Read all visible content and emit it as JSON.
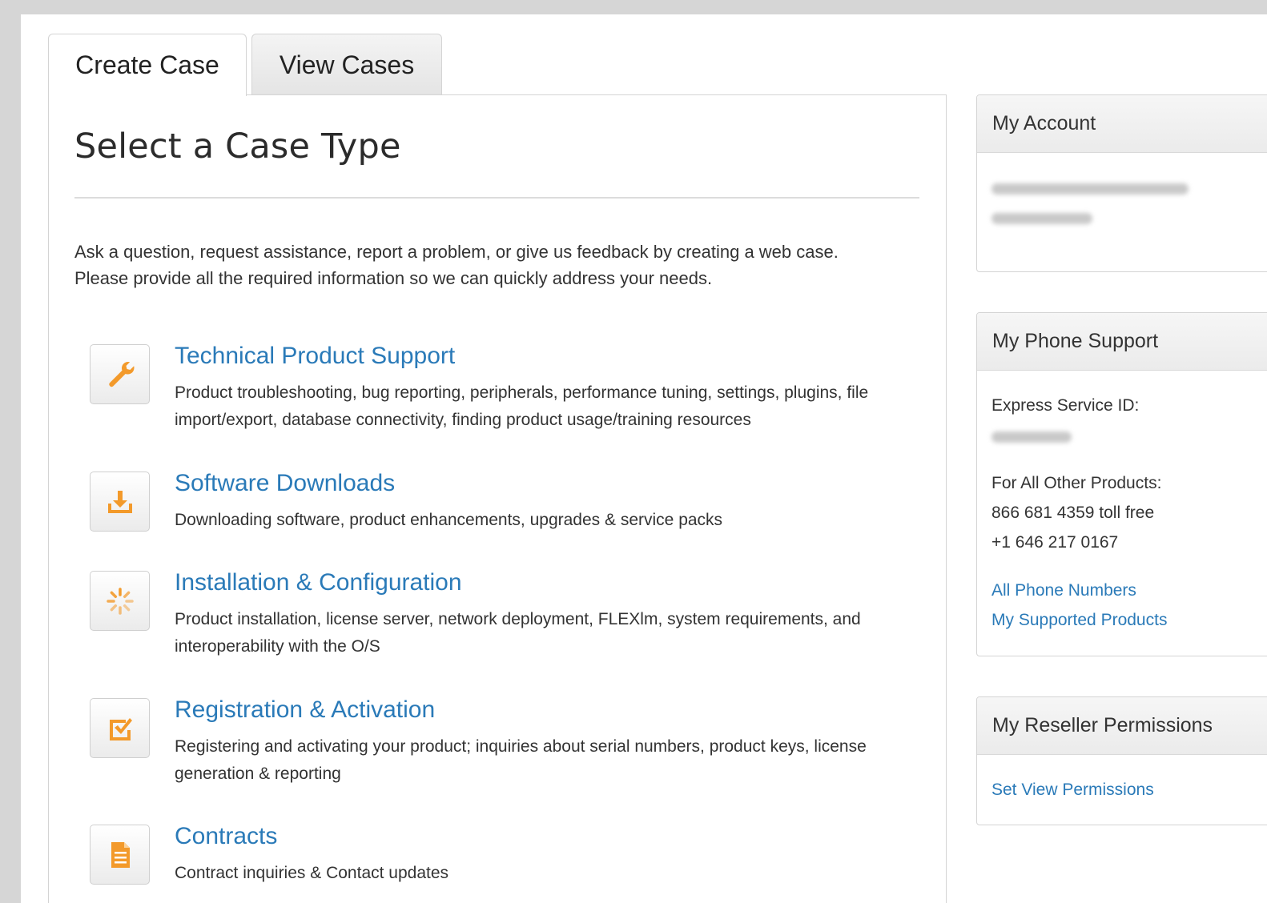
{
  "tabs": [
    {
      "label": "Create Case",
      "active": true
    },
    {
      "label": "View Cases",
      "active": false
    }
  ],
  "main": {
    "title": "Select a Case Type",
    "intro_line1": "Ask a question, request assistance, report a problem, or give us feedback by creating a web case.",
    "intro_line2": "Please provide all the required information so we can quickly address your needs.",
    "case_types": [
      {
        "title": "Technical Product Support",
        "icon": "wrench-icon",
        "description": "Product troubleshooting, bug reporting, peripherals, performance tuning, settings, plugins, file import/export, database connectivity, finding product usage/training resources"
      },
      {
        "title": "Software Downloads",
        "icon": "download-icon",
        "description": "Downloading software, product enhancements, upgrades & service packs"
      },
      {
        "title": "Installation & Configuration",
        "icon": "spinner-icon",
        "description": "Product installation, license server, network deployment, FLEXlm, system requirements, and interoperability with the O/S"
      },
      {
        "title": "Registration & Activation",
        "icon": "checkbox-icon",
        "description": "Registering and activating your product; inquiries about serial numbers, product keys, license generation & reporting"
      },
      {
        "title": "Contracts",
        "icon": "document-icon",
        "description": "Contract inquiries & Contact updates"
      }
    ]
  },
  "sidebar": {
    "account": {
      "heading": "My Account"
    },
    "phone": {
      "heading": "My Phone Support",
      "express_label": "Express Service ID:",
      "other_label": "For All Other Products:",
      "toll_free": "866 681 4359 toll free",
      "intl": "+1 646 217 0167",
      "link_all_numbers": "All Phone Numbers",
      "link_supported": "My Supported Products"
    },
    "reseller": {
      "heading": "My Reseller Permissions",
      "link_set_view": "Set View Permissions"
    }
  },
  "colors": {
    "link": "#2a7ab8",
    "icon_accent": "#f39a2b",
    "border": "#d4d4d4"
  }
}
